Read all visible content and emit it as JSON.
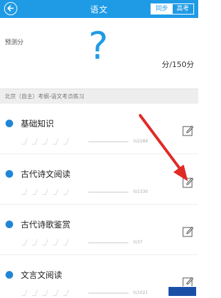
{
  "header": {
    "title": "语文",
    "tab_active": "同步",
    "tab_inactive": "高考"
  },
  "score": {
    "label": "预测分",
    "value": "?",
    "unit": "分/150分"
  },
  "section": {
    "title": "北京（自主）考纲-语文考点练习"
  },
  "items": [
    {
      "title": "基础知识",
      "count": "0/2289"
    },
    {
      "title": "古代诗文阅读",
      "count": "0/1330"
    },
    {
      "title": "古代诗歌鉴赏",
      "count": "0/37"
    },
    {
      "title": "文言文阅读",
      "count": "0/1021"
    }
  ],
  "colors": {
    "accent": "#1f9be6",
    "annotation_arrow": "#e02a25"
  },
  "icons": {
    "back": "back-arrow-icon",
    "edit": "pencil-edit-icon"
  }
}
